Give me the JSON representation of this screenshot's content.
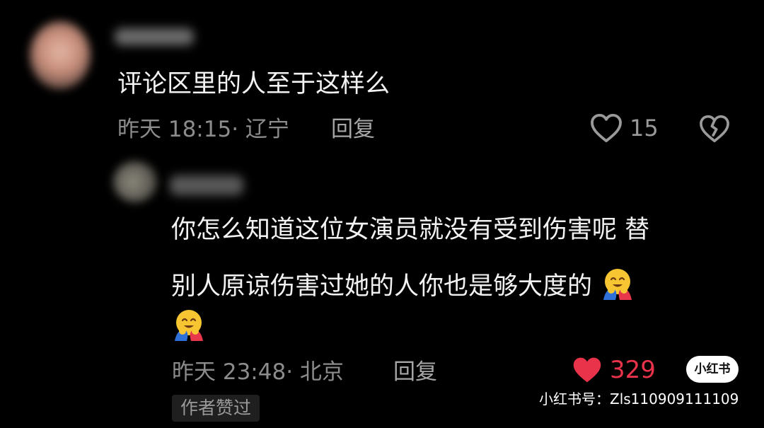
{
  "comment": {
    "text": "评论区里的人至于这样么",
    "meta": "昨天 18:15· 辽宁",
    "reply_label": "回复",
    "like_count": "15",
    "like_icon": "heart-outline-icon",
    "dislike_icon": "broken-heart-icon"
  },
  "reply": {
    "line1": "你怎么知道这位女演员就没有受到伤害呢 替",
    "line2": "别人原谅伤害过她的人你也是够大度的",
    "emoji": "hugging-face-emoji",
    "meta": "昨天 23:48· 北京",
    "reply_label": "回复",
    "like_count": "329",
    "like_icon": "heart-filled-icon",
    "author_badge": "作者赞过"
  },
  "watermark": {
    "logo": "小红书",
    "id_text": "小红书号：Zls110909111109"
  },
  "colors": {
    "background": "#000000",
    "text": "#f2f2f2",
    "meta": "#8c8c8c",
    "like_active": "#e8334a"
  }
}
